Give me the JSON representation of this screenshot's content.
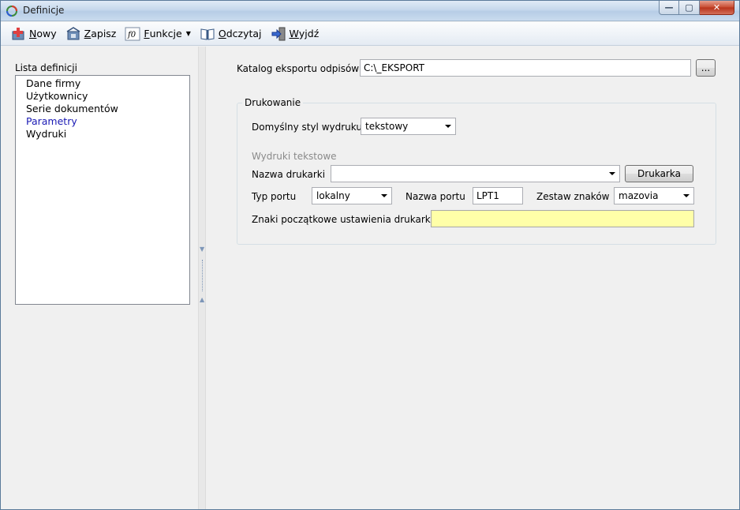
{
  "window": {
    "title": "Definicje",
    "controls": {
      "minimize": "—",
      "maximize": "▢",
      "close": "✕"
    }
  },
  "toolbar": {
    "items": [
      {
        "key": "N",
        "rest": "owy",
        "icon": "new-icon"
      },
      {
        "key": "Z",
        "rest": "apisz",
        "icon": "save-icon"
      },
      {
        "key": "F",
        "rest": "unkcje",
        "icon": "function-icon",
        "dropdown": true
      },
      {
        "key": "O",
        "rest": "dczytaj",
        "icon": "read-icon"
      },
      {
        "key": "W",
        "rest": "yjdź",
        "icon": "exit-icon"
      }
    ]
  },
  "left": {
    "label": "Lista definicji",
    "items": [
      "Dane firmy",
      "Użytkownicy",
      "Serie dokumentów",
      "Parametry",
      "Wydruki"
    ],
    "active_index": 3
  },
  "form": {
    "export_dir_label": "Katalog eksportu odpisów",
    "export_dir_value": "C:\\_EKSPORT",
    "browse_label": "...",
    "print_group_title": "Drukowanie",
    "default_style_label": "Domyślny styl wydruku",
    "default_style_value": "tekstowy",
    "text_prints_header": "Wydruki tekstowe",
    "printer_name_label": "Nazwa drukarki",
    "printer_name_value": "",
    "printer_button": "Drukarka",
    "port_type_label": "Typ portu",
    "port_type_value": "lokalny",
    "port_name_label": "Nazwa portu",
    "port_name_value": "LPT1",
    "charset_label": "Zestaw znaków",
    "charset_value": "mazovia",
    "init_chars_label": "Znaki początkowe ustawienia drukarki",
    "init_chars_value": ""
  },
  "colors": {
    "active_item": "#1a1ab4",
    "init_field_bg": "#ffffa8"
  }
}
